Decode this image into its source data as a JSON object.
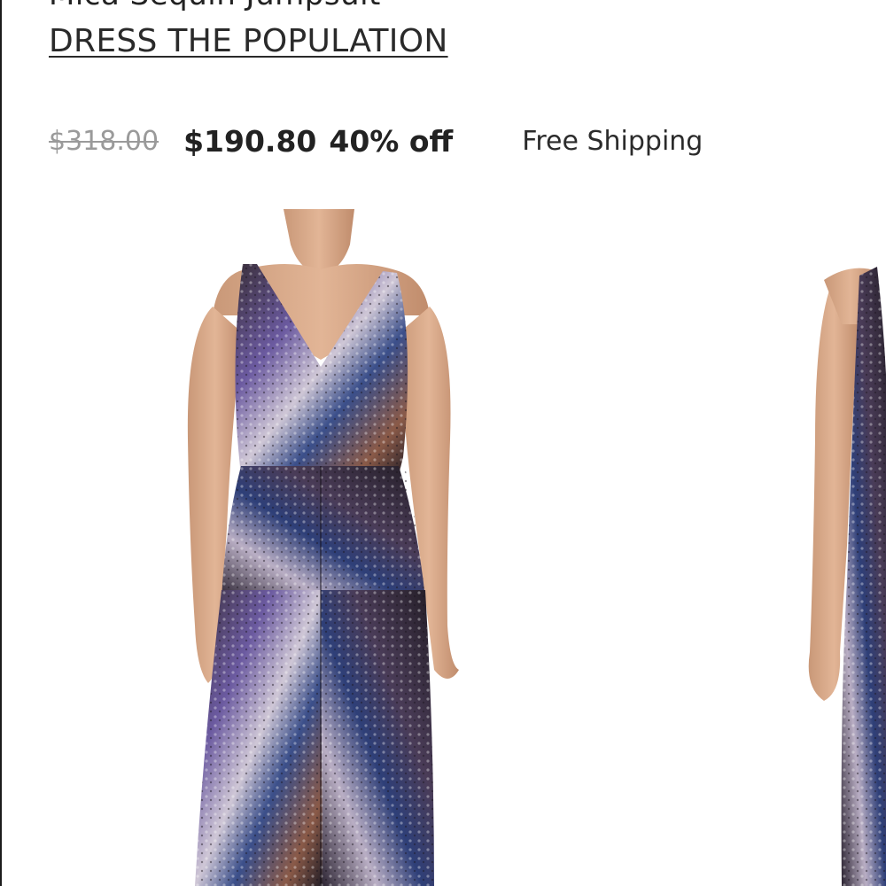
{
  "product": {
    "title_partial": "Mica Sequin Jumpsuit",
    "brand": "DRESS THE POPULATION"
  },
  "pricing": {
    "original_price": "$318.00",
    "sale_price": "$190.80",
    "discount": "40% off",
    "shipping": "Free Shipping"
  },
  "gallery": {
    "image_count_visible": 2,
    "subject": "sequin jumpsuit",
    "colors": {
      "skin": "#d7a888",
      "sequin_dark": "#2c2530",
      "sequin_blue": "#3b4f8a",
      "sequin_bronze": "#8a5a48",
      "sequin_light": "#cfc7d6"
    }
  }
}
